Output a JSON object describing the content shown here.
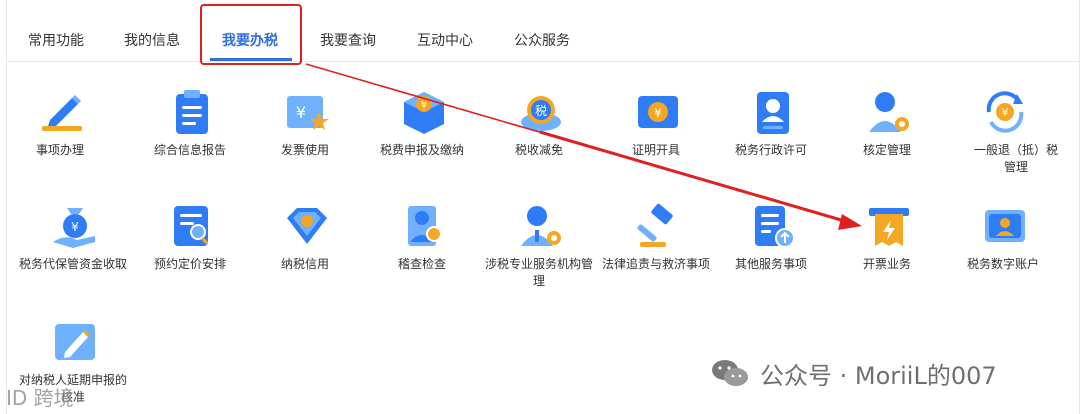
{
  "tabs": [
    {
      "label": "常用功能"
    },
    {
      "label": "我的信息"
    },
    {
      "label": "我要办税"
    },
    {
      "label": "我要查询"
    },
    {
      "label": "互动中心"
    },
    {
      "label": "公众服务"
    }
  ],
  "active_tab": "我要办税",
  "items": [
    {
      "label": "事项办理",
      "icon": "pen-icon"
    },
    {
      "label": "综合信息报告",
      "icon": "clipboard-icon"
    },
    {
      "label": "发票使用",
      "icon": "invoice-star-icon"
    },
    {
      "label": "税费申报及缴纳",
      "icon": "yuan-box-icon"
    },
    {
      "label": "税收减免",
      "icon": "tax-coin-icon"
    },
    {
      "label": "证明开具",
      "icon": "yuan-ticket-icon"
    },
    {
      "label": "税务行政许可",
      "icon": "id-card-icon"
    },
    {
      "label": "核定管理",
      "icon": "user-gear-icon"
    },
    {
      "label": "一般退（抵）税管理",
      "icon": "yuan-refresh-icon"
    },
    {
      "label": "税务代保管资金收取",
      "icon": "money-bag-hand-icon"
    },
    {
      "label": "预约定价安排",
      "icon": "document-search-icon"
    },
    {
      "label": "纳税信用",
      "icon": "diamond-check-icon"
    },
    {
      "label": "稽查检查",
      "icon": "inspector-icon"
    },
    {
      "label": "涉税专业服务机构管理",
      "icon": "agent-gear-icon"
    },
    {
      "label": "法律追责与救济事项",
      "icon": "gavel-icon"
    },
    {
      "label": "其他服务事项",
      "icon": "list-upload-icon"
    },
    {
      "label": "开票业务",
      "icon": "invoice-print-icon"
    },
    {
      "label": "税务数字账户",
      "icon": "digital-account-icon"
    },
    {
      "label": "对纳税人延期申报的核准",
      "icon": "ticket-pen-icon"
    }
  ],
  "watermark": {
    "text": "公众号 · MoriiL的007",
    "bottom_text": "ID 跨境"
  },
  "colors": {
    "accent": "#2f6fe0",
    "highlight": "#e02020",
    "icon_blue": "#2e7cf6",
    "icon_light": "#6fb0ff",
    "icon_orange": "#f5a623"
  }
}
